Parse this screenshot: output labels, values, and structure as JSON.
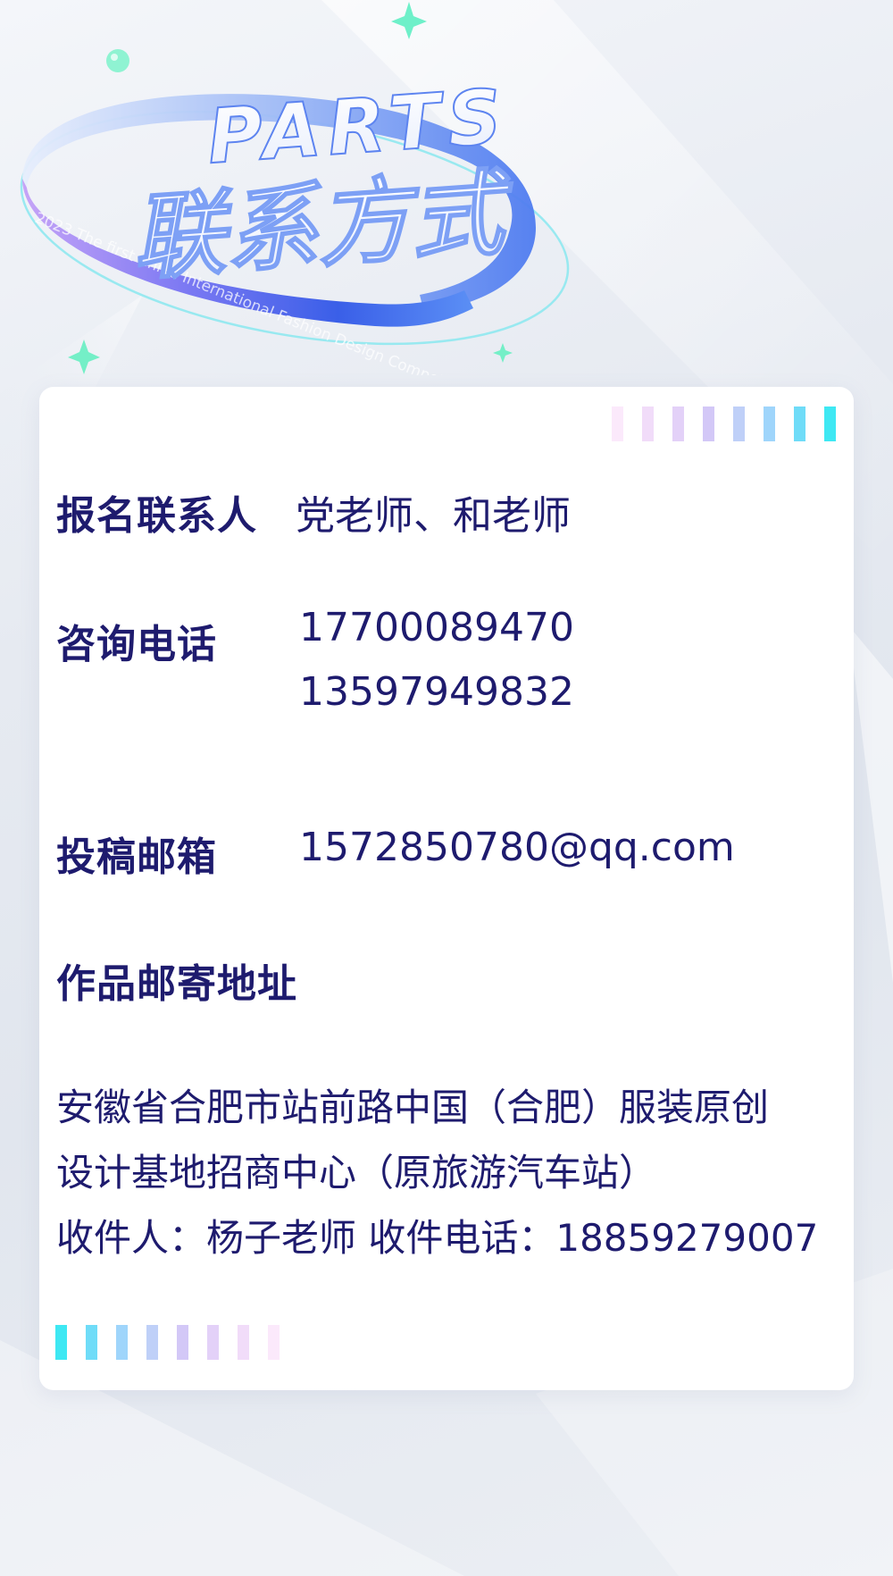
{
  "header": {
    "badge_text": "PARTS",
    "title": "联系方式",
    "ribbon_text": "2023 The first China International Fashion Design Competition"
  },
  "contacts": {
    "registration": {
      "label": "报名联系人",
      "value": "党老师、和老师"
    },
    "phone": {
      "label": "咨询电话",
      "values": [
        "17700089470",
        "13597949832"
      ]
    },
    "email": {
      "label": "投稿邮箱",
      "value": "1572850780@qq.com"
    },
    "mailing": {
      "label": "作品邮寄地址",
      "address_lines": [
        "安徽省合肥市站前路中国（合肥）服装原创",
        "设计基地招商中心（原旅游汽车站）",
        "收件人：杨子老师 收件电话：18859279007"
      ]
    }
  },
  "colors": {
    "text": "#1e1b6e",
    "ribbon_blue": "#3d6ff0",
    "ribbon_violet": "#a58af5",
    "accent_cyan": "#3ff0f5",
    "accent_pink": "#f6d8f8"
  },
  "decor": {
    "icons": [
      "sparkle-icon",
      "bubble-icon"
    ]
  }
}
